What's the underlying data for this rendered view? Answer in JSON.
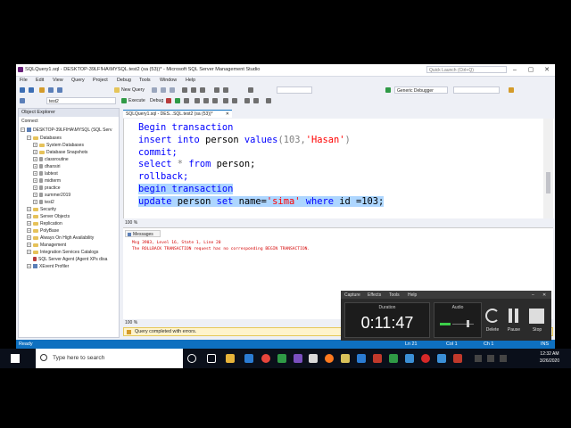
{
  "window": {
    "title": "SQLQuery1.sql - DESKTOP-39LF!HA\\MYSQL.test2 (sa (53))* - Microsoft SQL Server Management Studio",
    "quick_launch_placeholder": "Quick Launch (Ctrl+Q)"
  },
  "menu": [
    "File",
    "Edit",
    "View",
    "Query",
    "Project",
    "Debug",
    "Tools",
    "Window",
    "Help"
  ],
  "toolbar": {
    "new_query": "New Query",
    "debugger": "Generic Debugger",
    "database": "test2",
    "execute": "Execute",
    "debug": "Debug"
  },
  "object_explorer": {
    "title": "Object Explorer",
    "connect": "Connect",
    "server": "DESKTOP-39LFIHA\\MYSQL (SQL Serv",
    "databases_label": "Databases",
    "items": [
      "System Databases",
      "Database Snapshots",
      "classroutine",
      "dhansiri",
      "labtest",
      "midterm",
      "practice",
      "summer2019",
      "test2"
    ],
    "server_items": [
      "Security",
      "Server Objects",
      "Replication",
      "PolyBase",
      "Always On High Availability",
      "Management",
      "Integration Services Catalogs",
      "SQL Server Agent (Agent XPs disa",
      "XEvent Profiler"
    ]
  },
  "editor": {
    "tab_label": "SQLQuery1.sql - DES...SQL.test2 (sa (53))*",
    "zoom": "100 %",
    "lines": {
      "l1": "Begin transaction",
      "l2_kw": "insert into",
      "l2_obj": "person",
      "l2_kw2": "values",
      "l2_args": "(103,",
      "l2_str": "'Hasan'",
      "l2_end": ")",
      "l3": "commit;",
      "l4_kw": "select",
      "l4_mid": " * ",
      "l4_kw2": "from",
      "l4_end": " person;",
      "l5": "rollback;",
      "l6": "begin transaction",
      "l7_kw": "update",
      "l7_obj": " person ",
      "l7_kw2": "set",
      "l7_col": " name=",
      "l7_str": "'sima'",
      "l7_kw3": " where",
      "l7_tail": " id =103;"
    }
  },
  "results": {
    "tab": "Messages",
    "line1": "Msg 3903, Level 16, State 1, Line 20",
    "line2": "The ROLLBACK TRANSACTION request has no corresponding BEGIN TRANSACTION.",
    "zoom": "100 %",
    "status": "Query completed with errors."
  },
  "statusbar": {
    "ready": "Ready",
    "ln": "Ln 21",
    "col": "Col 1",
    "ch": "Ch 1",
    "ins": "INS"
  },
  "recorder": {
    "menu": [
      "Capture",
      "Effects",
      "Tools",
      "Help"
    ],
    "duration_label": "Duration",
    "duration": "0:11:47",
    "audio_label": "Audio",
    "buttons": [
      "Delete",
      "Pause",
      "Stop"
    ]
  },
  "taskbar": {
    "search_placeholder": "Type here to search",
    "time": "12:32 AM",
    "date": "3/26/2020"
  },
  "colors": {
    "accent": "#0e70c0",
    "keyword": "#0000ff",
    "string": "#ff0000",
    "error": "#d40000"
  }
}
